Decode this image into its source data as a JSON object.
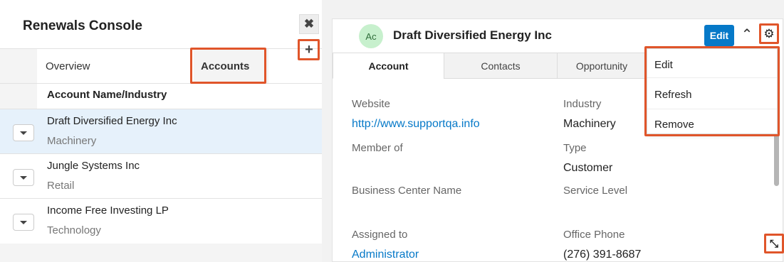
{
  "console": {
    "title": "Renewals Console",
    "tabs": [
      {
        "label": "Overview"
      },
      {
        "label": "Accounts"
      }
    ],
    "column_header": "Account Name/Industry",
    "rows": [
      {
        "name": "Draft Diversified Energy Inc",
        "industry": "Machinery",
        "selected": true
      },
      {
        "name": "Jungle Systems Inc",
        "industry": "Retail",
        "selected": false
      },
      {
        "name": "Income Free Investing LP",
        "industry": "Technology",
        "selected": false
      }
    ],
    "close_icon": "close-icon",
    "add_icon": "plus-icon"
  },
  "dashlet": {
    "avatar": "Ac",
    "title": "Draft Diversified Energy Inc",
    "edit_label": "Edit",
    "tabs": [
      {
        "label": "Account"
      },
      {
        "label": "Contacts"
      },
      {
        "label": "Opportunity"
      }
    ],
    "fields": {
      "website_label": "Website",
      "website_value": "http://www.supportqa.info",
      "industry_label": "Industry",
      "industry_value": "Machinery",
      "member_of_label": "Member of",
      "type_label": "Type",
      "type_value": "Customer",
      "business_center_label": "Business Center Name",
      "service_level_label": "Service Level",
      "assigned_to_label": "Assigned to",
      "assigned_to_value": "Administrator",
      "office_phone_label": "Office Phone",
      "office_phone_value": "(276) 391-8687"
    },
    "menu": [
      {
        "label": "Edit"
      },
      {
        "label": "Refresh"
      },
      {
        "label": "Remove"
      }
    ],
    "highlight_color": "#e0552a",
    "accent_color": "#0679c8"
  }
}
